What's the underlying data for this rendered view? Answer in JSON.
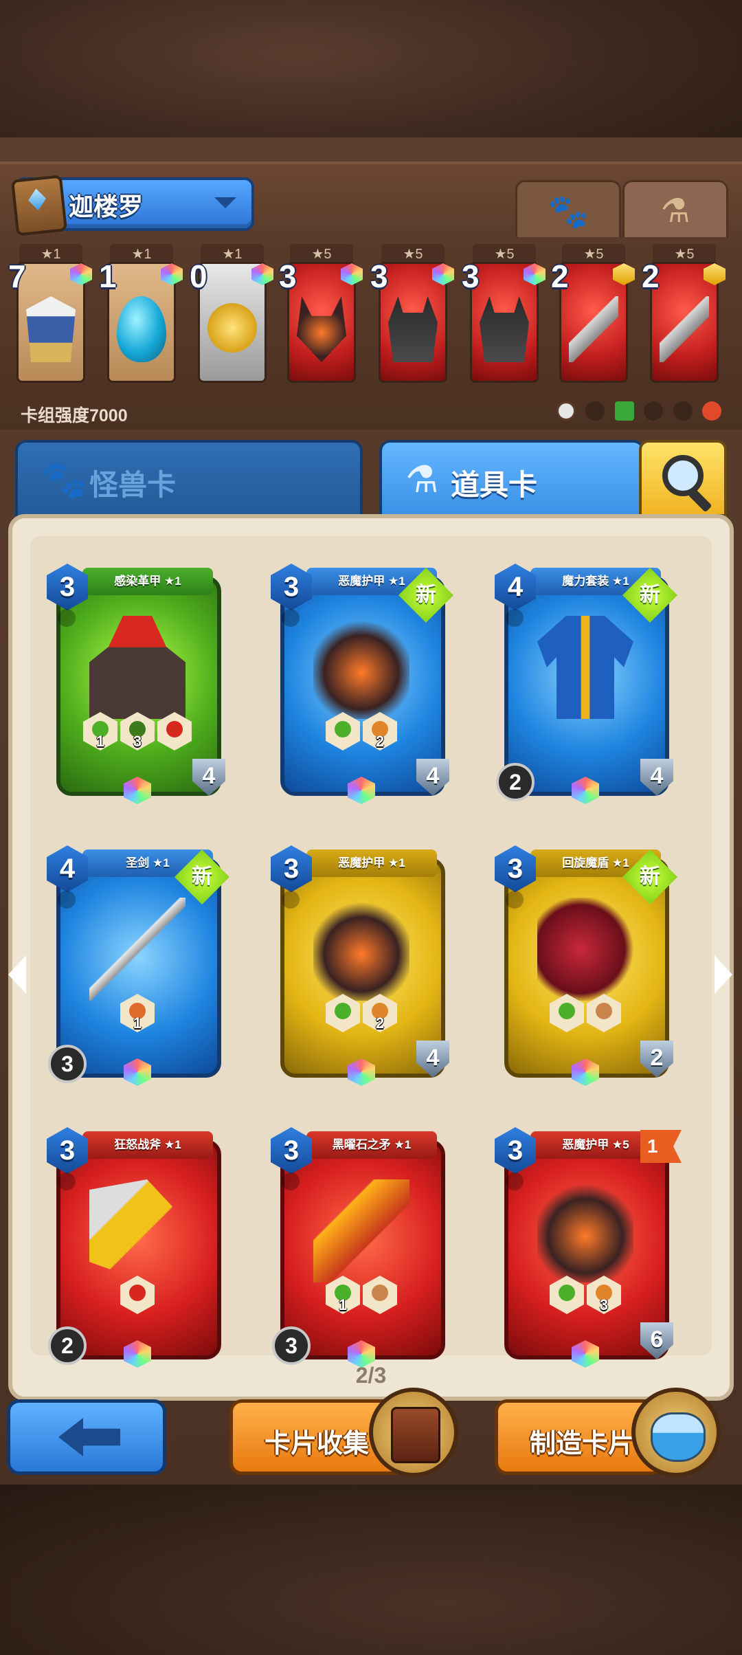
{
  "deck": {
    "name": "迦楼罗",
    "power_label": "卡组强度7000",
    "filter_tabs": [
      {
        "icon": "paw-icon",
        "active": false
      },
      {
        "icon": "potion-icon",
        "active": true
      }
    ],
    "cards": [
      {
        "stars": "★1",
        "count": "7",
        "color": "tan",
        "art": "armor-emblem",
        "gem": "rainbow"
      },
      {
        "stars": "★1",
        "count": "1",
        "color": "tan",
        "art": "blue-egg",
        "gem": "rainbow"
      },
      {
        "stars": "★1",
        "count": "0",
        "color": "gray",
        "art": "gold-coin",
        "gem": "rainbow"
      },
      {
        "stars": "★5",
        "count": "3",
        "color": "red",
        "art": "demon-armor",
        "gem": "rainbow"
      },
      {
        "stars": "★5",
        "count": "3",
        "color": "red",
        "art": "spiked-helmet",
        "gem": "rainbow"
      },
      {
        "stars": "★5",
        "count": "3",
        "color": "red",
        "art": "spiked-helmet",
        "gem": "rainbow"
      },
      {
        "stars": "★5",
        "count": "2",
        "color": "red",
        "art": "battle-axe",
        "gem": "gold"
      },
      {
        "stars": "★5",
        "count": "2",
        "color": "red",
        "art": "battle-axe",
        "gem": "gold"
      }
    ],
    "element_filters": [
      "all",
      "dark",
      "nature",
      "beast",
      "dragon",
      "fire"
    ]
  },
  "tabs": {
    "monster": "怪兽卡",
    "item": "道具卡"
  },
  "grid": {
    "page": "2/3",
    "cards": [
      {
        "name": "感染革甲 ★1",
        "cost": "3",
        "color": "green",
        "is_new": false,
        "flag": "",
        "skills": [
          {
            "color": "#4caf2a",
            "num": "1"
          },
          {
            "color": "#3c7a1c",
            "num": "3"
          },
          {
            "color": "#d6281f",
            "num": ""
          }
        ],
        "atk": "",
        "hp": "4",
        "art": "hooded-armor"
      },
      {
        "name": "恶魔护甲 ★1",
        "cost": "3",
        "color": "blue",
        "is_new": true,
        "flag": "",
        "skills": [
          {
            "color": "#4caf2a",
            "num": ""
          },
          {
            "color": "#e0862a",
            "num": "2"
          }
        ],
        "atk": "",
        "hp": "4",
        "art": "demon-armor"
      },
      {
        "name": "魔力套装 ★1",
        "cost": "4",
        "color": "blue",
        "is_new": true,
        "flag": "",
        "skills": [],
        "atk": "2",
        "hp": "4",
        "art": "mage-robe"
      },
      {
        "name": "圣剑 ★1",
        "cost": "4",
        "color": "blue",
        "is_new": true,
        "flag": "",
        "skills": [
          {
            "color": "#e06a2a",
            "num": "1"
          }
        ],
        "atk": "3",
        "hp": "",
        "art": "holy-sword"
      },
      {
        "name": "恶魔护甲 ★1",
        "cost": "3",
        "color": "yellow",
        "is_new": false,
        "flag": "",
        "skills": [
          {
            "color": "#4caf2a",
            "num": ""
          },
          {
            "color": "#e0862a",
            "num": "2"
          }
        ],
        "atk": "",
        "hp": "4",
        "art": "demon-armor"
      },
      {
        "name": "回旋魔盾 ★1",
        "cost": "3",
        "color": "yellow",
        "is_new": true,
        "flag": "",
        "skills": [
          {
            "color": "#4caf2a",
            "num": ""
          },
          {
            "color": "#c8844a",
            "num": ""
          }
        ],
        "atk": "",
        "hp": "2",
        "art": "dragon-shield"
      },
      {
        "name": "狂怒战斧 ★1",
        "cost": "3",
        "color": "red",
        "is_new": false,
        "flag": "",
        "skills": [
          {
            "color": "#d6281f",
            "num": ""
          }
        ],
        "atk": "2",
        "hp": "",
        "art": "battle-axe"
      },
      {
        "name": "黑曜石之矛 ★1",
        "cost": "3",
        "color": "red",
        "is_new": false,
        "flag": "",
        "skills": [
          {
            "color": "#4caf2a",
            "num": "1"
          },
          {
            "color": "#c8844a",
            "num": ""
          }
        ],
        "atk": "3",
        "hp": "",
        "art": "obsidian-spear"
      },
      {
        "name": "恶魔护甲 ★5",
        "cost": "3",
        "color": "red",
        "is_new": false,
        "flag": "1",
        "skills": [
          {
            "color": "#4caf2a",
            "num": ""
          },
          {
            "color": "#e0862a",
            "num": "3"
          }
        ],
        "atk": "",
        "hp": "6",
        "art": "demon-armor"
      }
    ],
    "new_badge": "新"
  },
  "bottom": {
    "collection_label": "卡片收集",
    "craft_label": "制造卡片"
  },
  "colors": {
    "accent_blue": "#3a8fe6",
    "accent_orange": "#f08a1c",
    "panel": "#efe5d3"
  }
}
